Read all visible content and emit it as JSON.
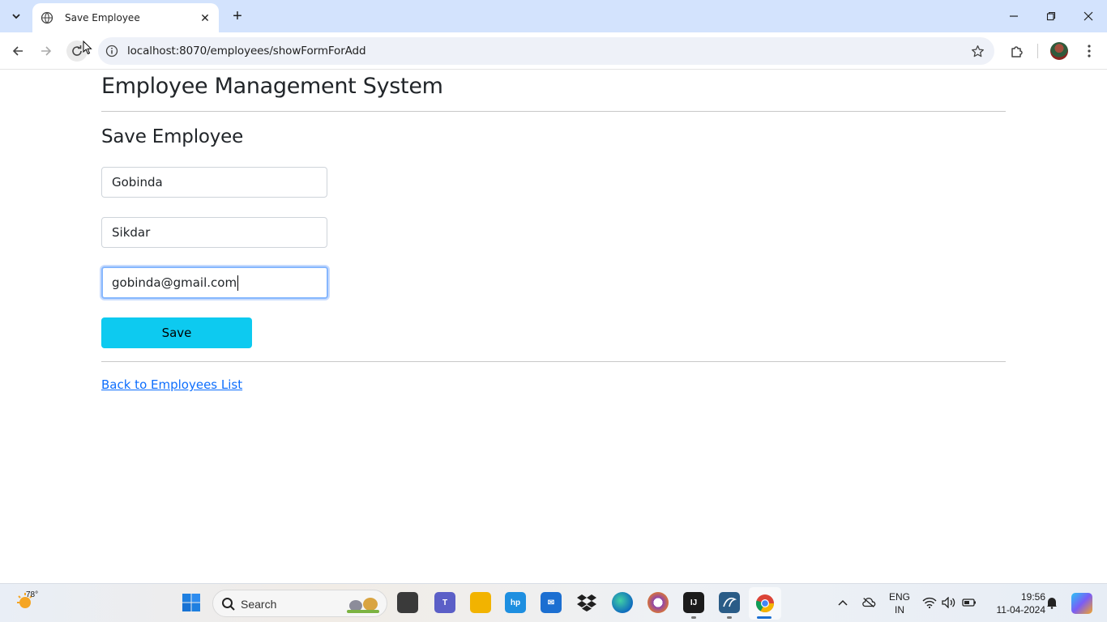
{
  "browser": {
    "tab_title": "Save Employee",
    "url": "localhost:8070/employees/showFormForAdd"
  },
  "page": {
    "site_title": "Employee Management System",
    "form_title": "Save Employee",
    "first_name_value": "Gobinda",
    "last_name_value": "Sikdar",
    "email_value": "gobinda@gmail.com",
    "save_label": "Save",
    "back_link": "Back to Employees List"
  },
  "taskbar": {
    "weather_temp": "78°",
    "search_label": "Search",
    "lang_1": "ENG",
    "lang_2": "IN",
    "time": "19:56",
    "date": "11-04-2024"
  },
  "colors": {
    "tabstrip": "#d3e3fd",
    "save_button": "#0dcaf0",
    "link": "#0d6efd"
  }
}
